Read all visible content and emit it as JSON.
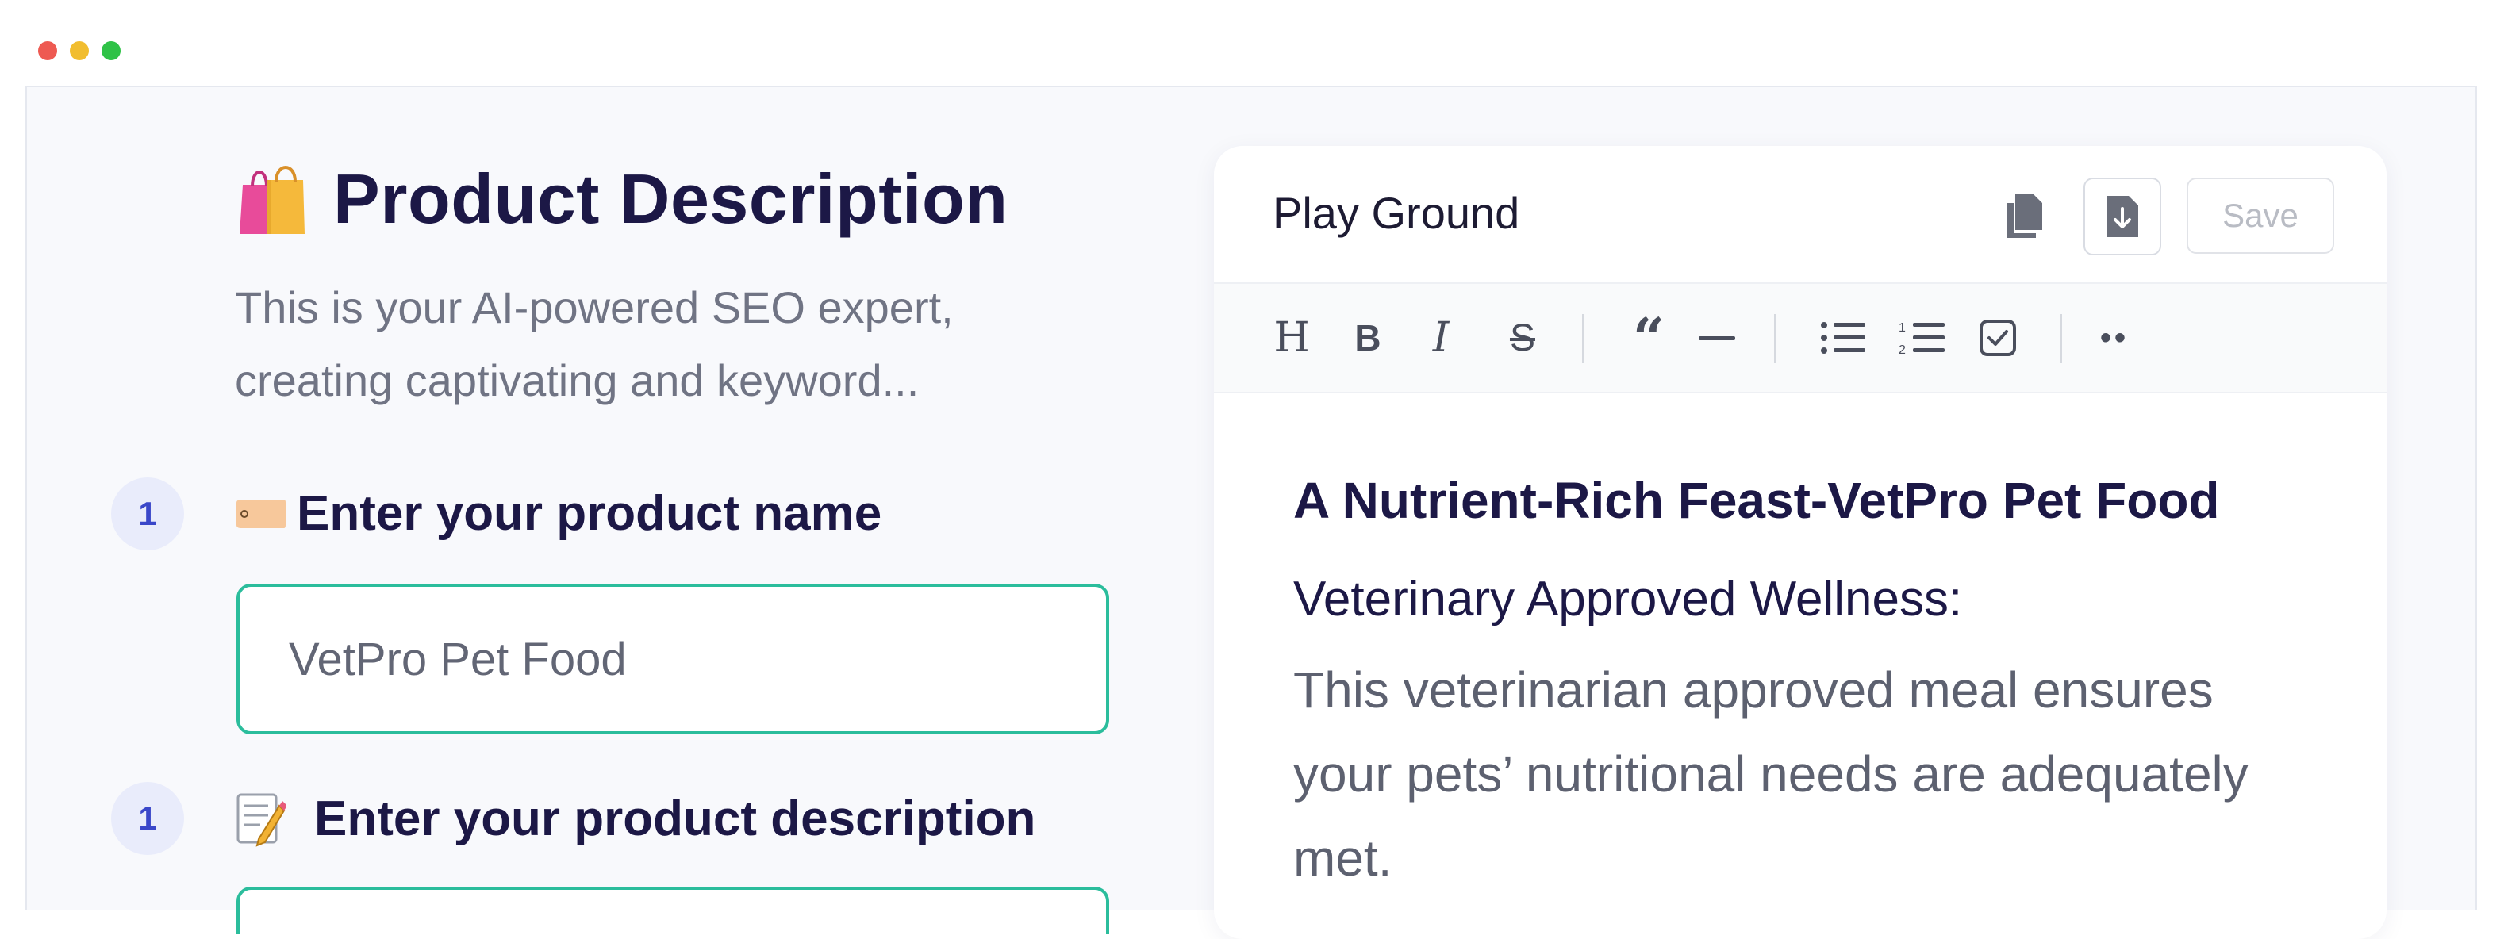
{
  "window": {
    "controls": [
      "close",
      "minimize",
      "maximize"
    ],
    "colors": {
      "close": "#ee5a52",
      "minimize": "#f1bd2f",
      "maximize": "#2fc247"
    }
  },
  "left": {
    "title": "Product Description",
    "title_icon": "shopping-bags-icon",
    "subtitle": "This is your AI-powered SEO expert, creating captivating and keyword...",
    "steps": [
      {
        "number": "1",
        "icon": "label-tag-icon",
        "label": "Enter your product name",
        "value": "VetPro Pet Food"
      },
      {
        "number": "1",
        "icon": "memo-icon",
        "label": "Enter your product description",
        "value": ""
      }
    ],
    "accent_color": "#2bbd9c"
  },
  "playground": {
    "title": "Play Ground",
    "save_label": "Save",
    "toolbar": {
      "heading": "H",
      "bold": "B",
      "italic": "I",
      "strike": "S",
      "quote": "“",
      "more": "••"
    },
    "content": {
      "heading": "A Nutrient-Rich Feast-VetPro Pet Food",
      "subheading": "Veterinary Approved Wellness:",
      "paragraph": "This veterinarian approved meal ensures your pets’ nutritional needs are adequately met."
    }
  }
}
